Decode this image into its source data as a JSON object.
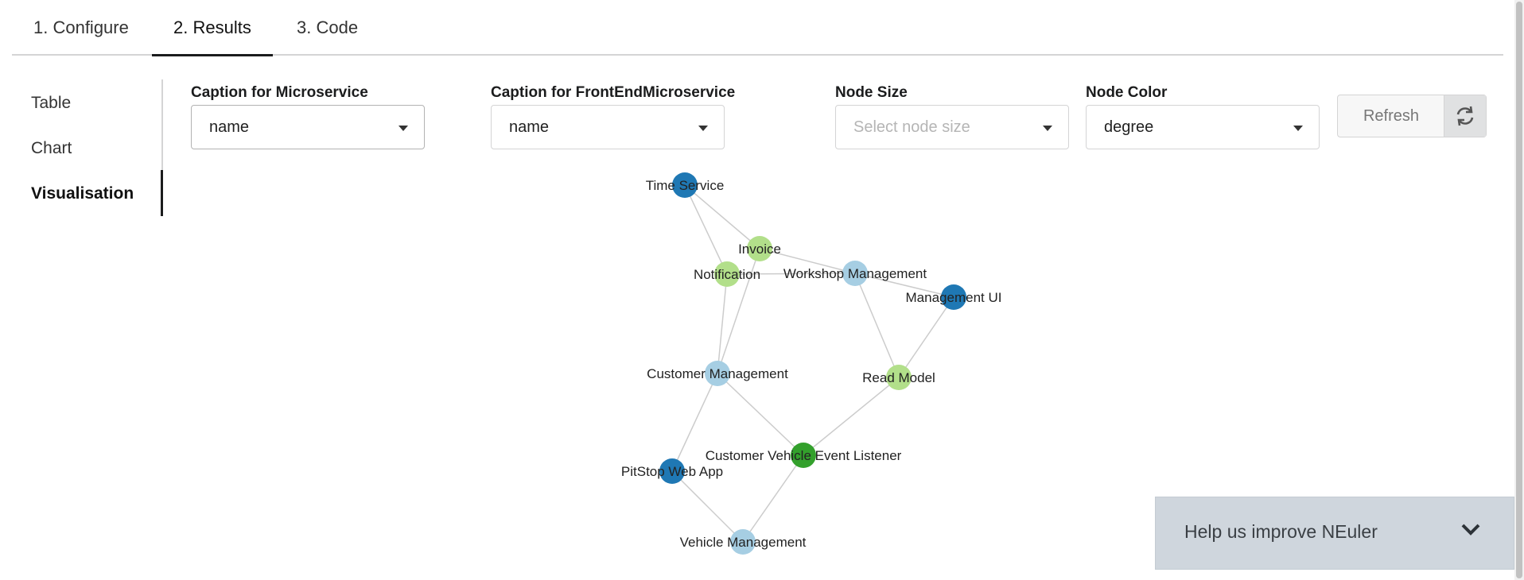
{
  "tabs": [
    {
      "label": "1. Configure",
      "active": false
    },
    {
      "label": "2. Results",
      "active": true
    },
    {
      "label": "3. Code",
      "active": false
    }
  ],
  "sidebar": {
    "items": [
      {
        "label": "Table",
        "active": false
      },
      {
        "label": "Chart",
        "active": false
      },
      {
        "label": "Visualisation",
        "active": true
      }
    ]
  },
  "controls": {
    "caption_microservice": {
      "label": "Caption for Microservice",
      "value": "name"
    },
    "caption_frontend": {
      "label": "Caption for FrontEndMicroservice",
      "value": "name"
    },
    "node_size": {
      "label": "Node Size",
      "placeholder": "Select node size"
    },
    "node_color": {
      "label": "Node Color",
      "value": "degree"
    },
    "refresh_label": "Refresh",
    "refresh_icon": "refresh-icon"
  },
  "graph": {
    "colors": {
      "dark_blue": "#1f78b4",
      "light_blue": "#a6cee3",
      "light_green": "#b2df8a",
      "green": "#33a02c",
      "edge": "#cccccc"
    },
    "nodes": [
      {
        "id": "time",
        "label": "Time Service",
        "color": "dark_blue"
      },
      {
        "id": "invoice",
        "label": "Invoice",
        "color": "light_green"
      },
      {
        "id": "notification",
        "label": "Notification",
        "color": "light_green"
      },
      {
        "id": "workshop",
        "label": "Workshop Management",
        "color": "light_blue"
      },
      {
        "id": "mgmtui",
        "label": "Management UI",
        "color": "dark_blue"
      },
      {
        "id": "customer",
        "label": "Customer Management",
        "color": "light_blue"
      },
      {
        "id": "readmodel",
        "label": "Read Model",
        "color": "light_green"
      },
      {
        "id": "cvel",
        "label": "Customer Vehicle Event Listener",
        "color": "green"
      },
      {
        "id": "pitstop",
        "label": "PitStop Web App",
        "color": "dark_blue"
      },
      {
        "id": "vehicle",
        "label": "Vehicle Management",
        "color": "light_blue"
      }
    ],
    "edges": [
      [
        "time",
        "invoice"
      ],
      [
        "time",
        "notification"
      ],
      [
        "invoice",
        "workshop"
      ],
      [
        "invoice",
        "customer"
      ],
      [
        "notification",
        "workshop"
      ],
      [
        "notification",
        "customer"
      ],
      [
        "workshop",
        "mgmtui"
      ],
      [
        "workshop",
        "readmodel"
      ],
      [
        "mgmtui",
        "readmodel"
      ],
      [
        "customer",
        "cvel"
      ],
      [
        "customer",
        "pitstop"
      ],
      [
        "readmodel",
        "cvel"
      ],
      [
        "cvel",
        "vehicle"
      ],
      [
        "pitstop",
        "vehicle"
      ]
    ]
  },
  "help": {
    "label": "Help us improve NEuler",
    "icon": "chevron-down-icon"
  }
}
